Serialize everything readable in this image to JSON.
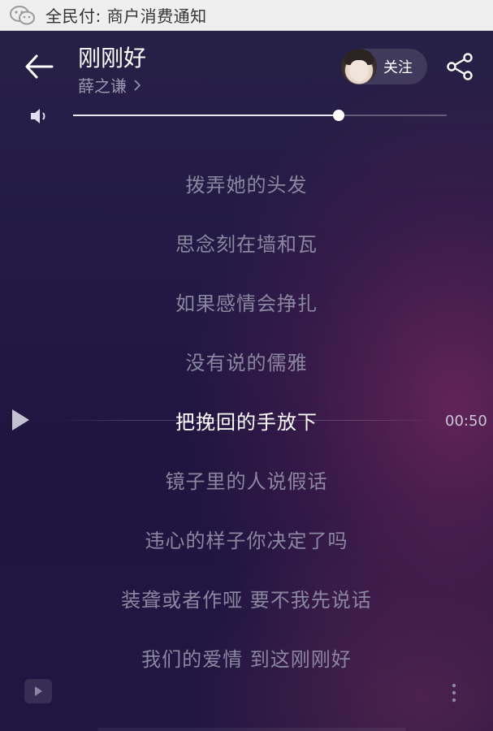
{
  "notification": {
    "icon": "wechat-icon",
    "text": "全民付: 商户消费通知"
  },
  "header": {
    "back_icon": "back-arrow-icon",
    "song_title": "刚刚好",
    "artist": "薛之谦",
    "follow_label": "关注",
    "share_icon": "share-icon"
  },
  "volume": {
    "icon": "speaker-icon",
    "level": 0.71
  },
  "lyrics": [
    "拨弄她的头发",
    "思念刻在墙和瓦",
    "如果感情会挣扎",
    "没有说的儒雅",
    "把挽回的手放下",
    "镜子里的人说假话",
    "违心的样子你决定了吗",
    "装聋或者作哑 要不我先说话",
    "我们的爱情 到这刚刚好"
  ],
  "current_lyric_index": 4,
  "current_time": "00:50",
  "colors": {
    "accent": "#ffffff",
    "lyric_dim": "#8b87a0",
    "background_top": "#272046",
    "background_glow": "#78285f"
  }
}
